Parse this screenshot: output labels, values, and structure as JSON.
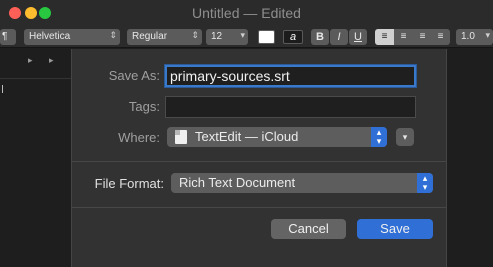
{
  "window": {
    "title": "Untitled",
    "title_status": "— Edited"
  },
  "toolbar": {
    "paragraph_style": "¶",
    "font_family": "Helvetica",
    "font_style": "Regular",
    "font_size": "12",
    "text_color_label": "a",
    "bold_label": "B",
    "italic_label": "I",
    "underline_label": "U",
    "alignment_options": [
      "left",
      "center",
      "right",
      "justify"
    ],
    "alignment_selected": "left",
    "line_spacing": "1.0"
  },
  "save_dialog": {
    "save_as_label": "Save As:",
    "save_as_value": "primary-sources.srt",
    "tags_label": "Tags:",
    "tags_value": "",
    "where_label": "Where:",
    "where_value": "TextEdit — iCloud",
    "file_format_label": "File Format:",
    "file_format_value": "Rich Text Document",
    "cancel_label": "Cancel",
    "save_label": "Save"
  },
  "colors": {
    "accent": "#2f6fd6",
    "focus_ring": "#3a78c9",
    "close": "#fe5f57",
    "minimize": "#febc2e",
    "zoom": "#28c840"
  }
}
